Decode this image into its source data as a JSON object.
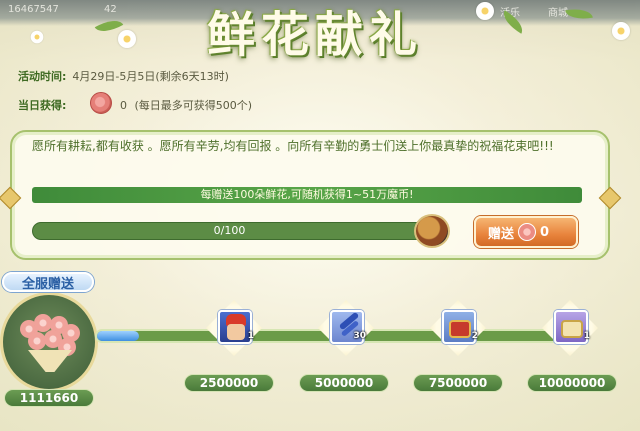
{
  "header": {
    "title": "鲜花献礼",
    "top_strip": [
      "16467547",
      "42",
      "活乐",
      "商城"
    ]
  },
  "event": {
    "time_label": "活动时间:",
    "time_value": "4月29日-5月5日(剩余6天13时)",
    "today_label": "当日获得:",
    "today_count": "0",
    "today_limit": "(每日最多可获得500个)"
  },
  "panel": {
    "description": "愿所有耕耘,都有收获 。愿所有辛劳,均有回报 。向所有辛勤的勇士们送上你最真挚的祝福花束吧!!!",
    "banner": "每赠送100朵鲜花,可随机获得1~51万魔币!",
    "progress_text": "0/100",
    "progress": 0,
    "give_label": "赠送",
    "give_count": "0"
  },
  "server": {
    "label": "全服赠送",
    "total": "1111660",
    "progress_fraction": 0.09
  },
  "rewards": [
    {
      "icon": "hero-portrait-icon",
      "count": "1",
      "threshold": "2500000"
    },
    {
      "icon": "blue-feather-icon",
      "count": "30",
      "threshold": "5000000"
    },
    {
      "icon": "red-chest-icon",
      "count": "2",
      "threshold": "7500000"
    },
    {
      "icon": "gold-chest-icon",
      "count": "1",
      "threshold": "10000000"
    }
  ],
  "colors": {
    "accent_green": "#4d6f2a",
    "button_orange": "#e8833c",
    "progress_blue": "#3f8fe0"
  }
}
